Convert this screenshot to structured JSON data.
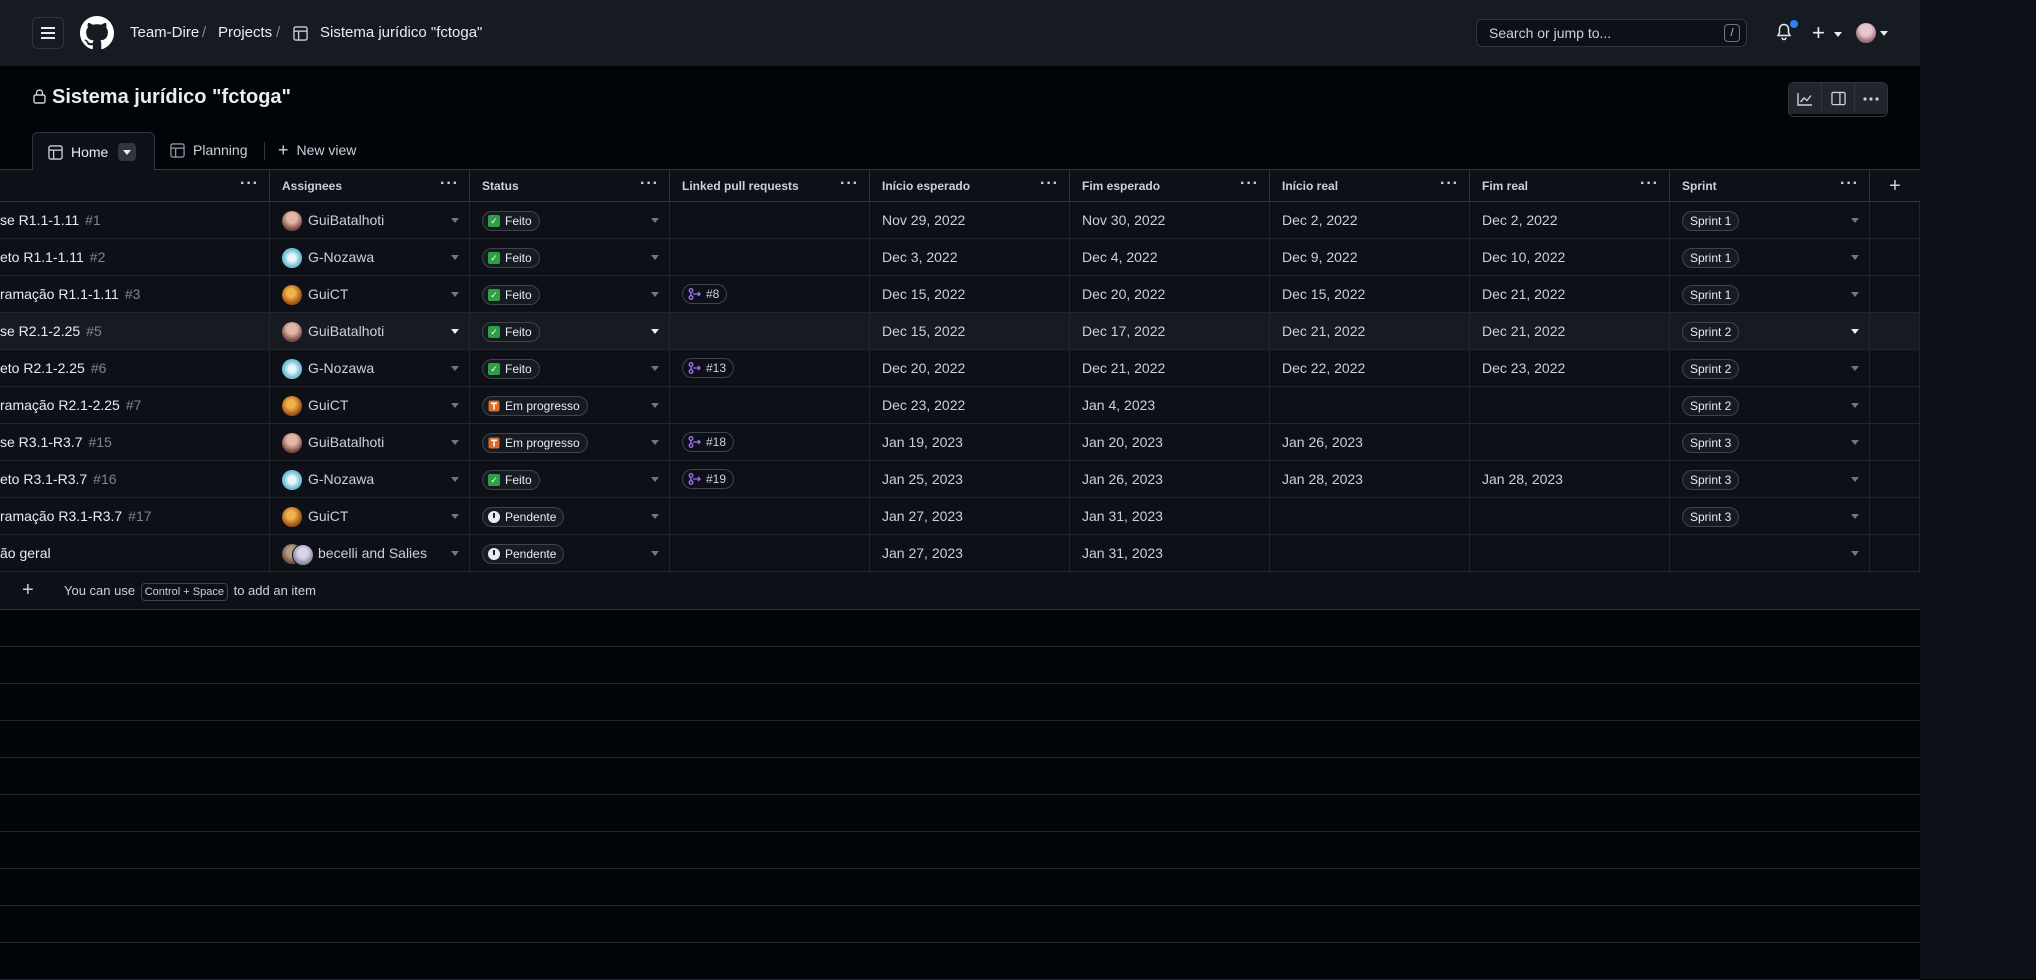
{
  "header": {
    "breadcrumb": [
      "Team-Dire",
      "Projects",
      "Sistema jurídico \"fctoga\""
    ],
    "separator": "/",
    "search_placeholder": "Search or jump to...",
    "search_shortcut": "/",
    "plus_label": "+"
  },
  "project": {
    "title": "Sistema jurídico \"fctoga\""
  },
  "tabs": {
    "home": "Home",
    "planning": "Planning",
    "new_view": "New view"
  },
  "table": {
    "columns": [
      "Assignees",
      "Status",
      "Linked pull requests",
      "Início esperado",
      "Fim esperado",
      "Início real",
      "Fim real",
      "Sprint"
    ],
    "rows": [
      {
        "title": "se R1.1-1.11",
        "num": "#1",
        "assignee": "GuiBatalhoti",
        "avatar": "gb",
        "status": "Feito",
        "status_type": "done",
        "pr": "",
        "start": "Nov 29, 2022",
        "end": "Nov 30, 2022",
        "start_real": "Dec 2, 2022",
        "end_real": "Dec 2, 2022",
        "sprint": "Sprint 1"
      },
      {
        "title": "eto R1.1-1.11",
        "num": "#2",
        "assignee": "G-Nozawa",
        "avatar": "gn",
        "status": "Feito",
        "status_type": "done",
        "pr": "",
        "start": "Dec 3, 2022",
        "end": "Dec 4, 2022",
        "start_real": "Dec 9, 2022",
        "end_real": "Dec 10, 2022",
        "sprint": "Sprint 1"
      },
      {
        "title": "ramação R1.1-1.11",
        "num": "#3",
        "assignee": "GuiCT",
        "avatar": "gc",
        "status": "Feito",
        "status_type": "done",
        "pr": "#8",
        "start": "Dec 15, 2022",
        "end": "Dec 20, 2022",
        "start_real": "Dec 15, 2022",
        "end_real": "Dec 21, 2022",
        "sprint": "Sprint 1"
      },
      {
        "title": "se R2.1-2.25",
        "num": "#5",
        "assignee": "GuiBatalhoti",
        "avatar": "gb",
        "status": "Feito",
        "status_type": "done",
        "pr": "",
        "start": "Dec 15, 2022",
        "end": "Dec 17, 2022",
        "start_real": "Dec 21, 2022",
        "end_real": "Dec 21, 2022",
        "sprint": "Sprint 2",
        "highlighted": true
      },
      {
        "title": "eto R2.1-2.25",
        "num": "#6",
        "assignee": "G-Nozawa",
        "avatar": "gn",
        "status": "Feito",
        "status_type": "done",
        "pr": "#13",
        "start": "Dec 20, 2022",
        "end": "Dec 21, 2022",
        "start_real": "Dec 22, 2022",
        "end_real": "Dec 23, 2022",
        "sprint": "Sprint 2"
      },
      {
        "title": "ramação R2.1-2.25",
        "num": "#7",
        "assignee": "GuiCT",
        "avatar": "gc",
        "status": "Em progresso",
        "status_type": "progress",
        "pr": "",
        "start": "Dec 23, 2022",
        "end": "Jan 4, 2023",
        "start_real": "",
        "end_real": "",
        "sprint": "Sprint 2"
      },
      {
        "title": "se R3.1-R3.7",
        "num": "#15",
        "assignee": "GuiBatalhoti",
        "avatar": "gb",
        "status": "Em progresso",
        "status_type": "progress",
        "pr": "#18",
        "start": "Jan 19, 2023",
        "end": "Jan 20, 2023",
        "start_real": "Jan 26, 2023",
        "end_real": "",
        "sprint": "Sprint 3"
      },
      {
        "title": "eto R3.1-R3.7",
        "num": "#16",
        "assignee": "G-Nozawa",
        "avatar": "gn",
        "status": "Feito",
        "status_type": "done",
        "pr": "#19",
        "start": "Jan 25, 2023",
        "end": "Jan 26, 2023",
        "start_real": "Jan 28, 2023",
        "end_real": "Jan 28, 2023",
        "sprint": "Sprint 3"
      },
      {
        "title": "ramação R3.1-R3.7",
        "num": "#17",
        "assignee": "GuiCT",
        "avatar": "gc",
        "status": "Pendente",
        "status_type": "pending",
        "pr": "",
        "start": "Jan 27, 2023",
        "end": "Jan 31, 2023",
        "start_real": "",
        "end_real": "",
        "sprint": "Sprint 3"
      },
      {
        "title": "ão geral",
        "num": "",
        "assignee": "becelli and Salies",
        "avatar": "bs",
        "status": "Pendente",
        "status_type": "pending",
        "pr": "",
        "start": "Jan 27, 2023",
        "end": "Jan 31, 2023",
        "start_real": "",
        "end_real": "",
        "sprint": ""
      }
    ]
  },
  "add_item": {
    "prefix": "You can use",
    "key1": "Control",
    "joiner": "+",
    "key2": "Space",
    "suffix": "to add an item"
  },
  "colors": {
    "background": "#010409",
    "surface": "#0d1117",
    "border": "#30363d",
    "done": "#2ea043",
    "progress": "#db6d28",
    "pr": "#a371f7",
    "notification": "#2f81f7"
  }
}
